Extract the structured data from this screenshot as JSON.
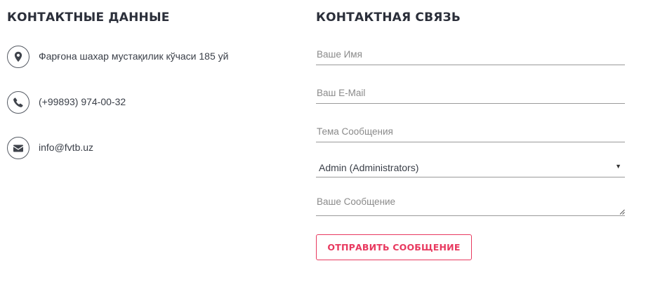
{
  "contacts": {
    "title": "КОНТАКТНЫЕ ДАННЫЕ",
    "address": "Фарғона шахар мустақилик кўчаси 185 уй",
    "phone": "(+99893) 974-00-32",
    "email": "info@fvtb.uz",
    "icons": [
      "map-marker-icon",
      "phone-icon",
      "envelope-icon"
    ]
  },
  "form": {
    "title": "КОНТАКТНАЯ СВЯЗЬ",
    "name_placeholder": "Ваше Имя",
    "email_placeholder": "Ваш E-Mail",
    "subject_placeholder": "Тема Сообщения",
    "recipient_selected": "Admin (Administrators)",
    "message_placeholder": "Ваше Сообщение",
    "submit_label": "ОТПРАВИТЬ СООБЩЕНИЕ"
  },
  "colors": {
    "accent": "#e8395f",
    "text": "#333740",
    "field_border": "#9a9a9a"
  }
}
